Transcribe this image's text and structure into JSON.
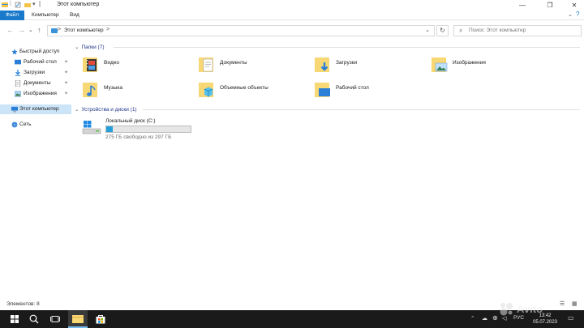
{
  "window": {
    "title": "Этот компьютер"
  },
  "ribbon": {
    "tabs": [
      {
        "label": "Файл"
      },
      {
        "label": "Компьютер"
      },
      {
        "label": "Вид"
      }
    ]
  },
  "address": {
    "path": "Этот компьютер",
    "separator": ">"
  },
  "search": {
    "placeholder": "Поиск: Этот компьютер"
  },
  "sidebar": {
    "items": [
      {
        "label": "Быстрый доступ",
        "icon": "star-icon"
      },
      {
        "label": "Рабочий стол",
        "icon": "desktop-icon",
        "pinned": true
      },
      {
        "label": "Загрузки",
        "icon": "download-icon",
        "pinned": true
      },
      {
        "label": "Документы",
        "icon": "documents-icon",
        "pinned": true
      },
      {
        "label": "Изображения",
        "icon": "pictures-icon",
        "pinned": true
      },
      {
        "label": "Этот компьютер",
        "icon": "computer-icon",
        "selected": true
      },
      {
        "label": "Сеть",
        "icon": "network-icon"
      }
    ]
  },
  "folders": {
    "header": "Папки (7)",
    "items": [
      {
        "name": "Видео",
        "icon": "video-folder-icon"
      },
      {
        "name": "Документы",
        "icon": "documents-folder-icon"
      },
      {
        "name": "Загрузки",
        "icon": "downloads-folder-icon"
      },
      {
        "name": "Изображения",
        "icon": "pictures-folder-icon"
      },
      {
        "name": "Музыка",
        "icon": "music-folder-icon"
      },
      {
        "name": "Объемные объекты",
        "icon": "3d-objects-folder-icon"
      },
      {
        "name": "Рабочий стол",
        "icon": "desktop-folder-icon"
      }
    ]
  },
  "devices": {
    "header": "Устройства и диски (1)",
    "drives": [
      {
        "name": "Локальный диск (C:)",
        "free_text": "275 ГБ свободно из 297 ГБ",
        "used_fraction": 0.074
      }
    ]
  },
  "status": {
    "items_count": "Элементов: 8"
  },
  "taskbar": {
    "clock_time": "13:42",
    "clock_date": "05.07.2023",
    "language": "РУС",
    "watermark": "Avito"
  },
  "colors": {
    "accent": "#1979ca",
    "selection": "#cce4f7",
    "folder_yellow": "#f8d775",
    "drive_fill": "#26a0da",
    "taskbar": "#1a1a1a"
  }
}
